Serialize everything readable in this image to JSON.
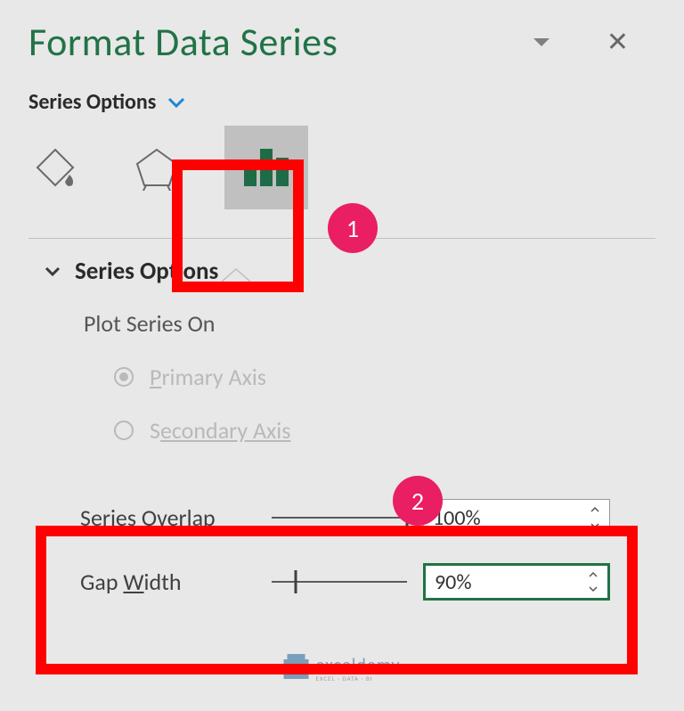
{
  "header": {
    "title": "Format Data Series"
  },
  "dropdown": {
    "label": "Series Options"
  },
  "tabs": {
    "fill": "fill-icon",
    "effects": "effects-icon",
    "series": "series-options-icon"
  },
  "annotations": {
    "badge1": "1",
    "badge2": "2"
  },
  "section": {
    "title": "Series Options",
    "plot_on_label": "Plot Series On",
    "primary_prefix": "P",
    "primary_rest": "rimary Axis",
    "secondary_prefix": "S",
    "secondary_rest": "econdary Axis"
  },
  "sliders": {
    "overlap": {
      "label_pre": "Series ",
      "label_u": "O",
      "label_post": "verlap",
      "value": "100%",
      "thumb_pos": "100%"
    },
    "gap": {
      "label_pre": "Gap ",
      "label_u": "W",
      "label_post": "idth",
      "value": "90%",
      "thumb_pos": "18%"
    }
  },
  "watermark": {
    "name": "exceldemy",
    "sub": "EXCEL · DATA · BI"
  }
}
